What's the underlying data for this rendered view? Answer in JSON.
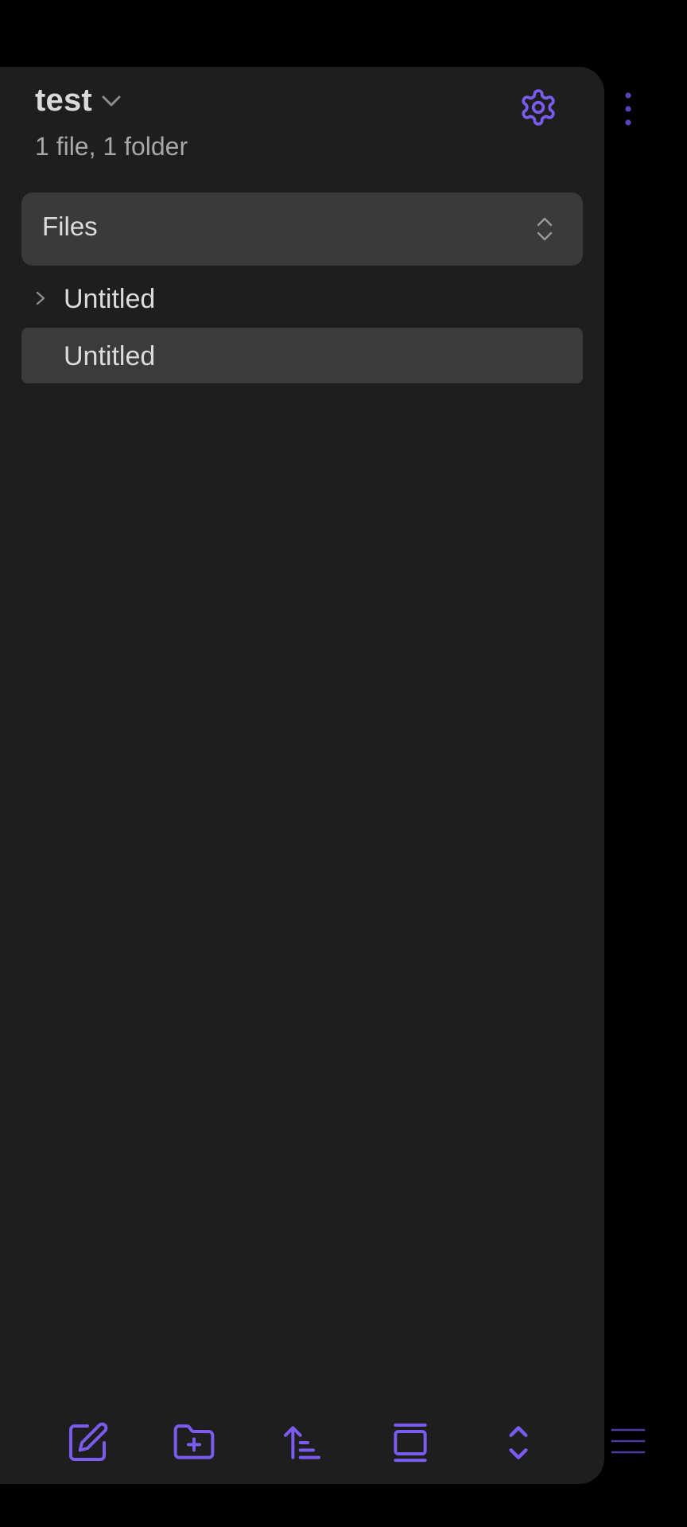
{
  "vault": {
    "name": "test",
    "stats": "1 file, 1 folder"
  },
  "view_select": {
    "selected": "Files"
  },
  "tree": {
    "items": [
      {
        "type": "folder",
        "label": "Untitled",
        "collapsed": true
      },
      {
        "type": "file",
        "label": "Untitled",
        "selected": true
      }
    ]
  },
  "bottom_bar": {
    "buttons": [
      {
        "icon": "new-note-icon"
      },
      {
        "icon": "new-folder-icon"
      },
      {
        "icon": "sort-icon"
      },
      {
        "icon": "collapse-all-icon"
      },
      {
        "icon": "expand-collapse-icon"
      }
    ]
  },
  "colors": {
    "accent": "#7c5bf0",
    "drawer_bg": "#1e1e1e",
    "selected_bg": "#3b3b3b",
    "text": "#dcdcdc",
    "muted_text": "#a8a8a8"
  }
}
